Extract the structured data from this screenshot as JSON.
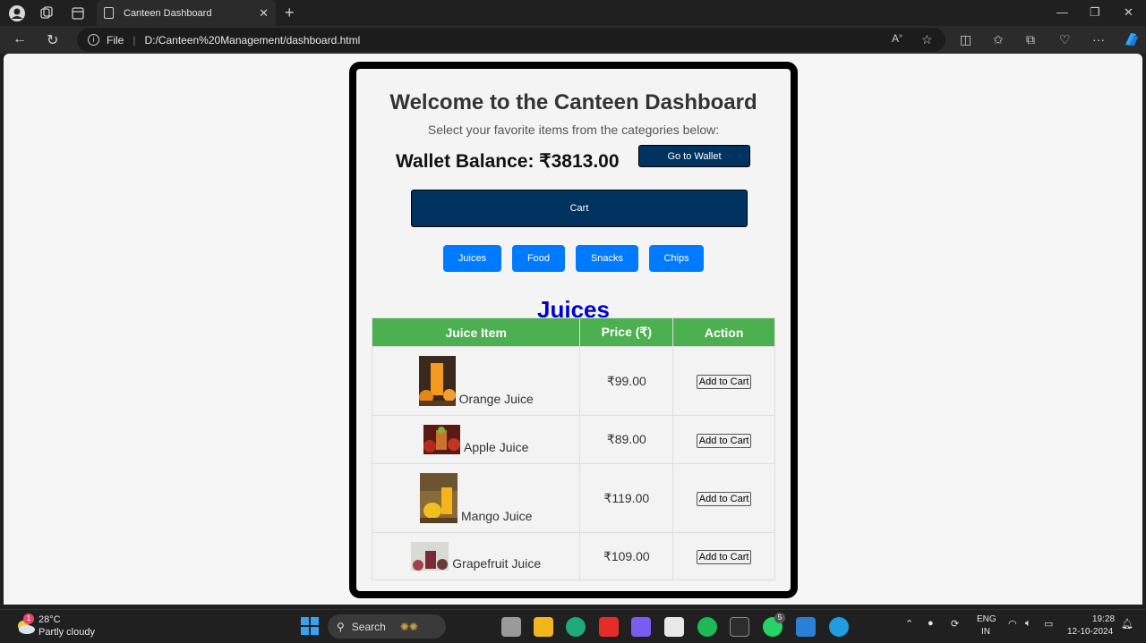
{
  "browser": {
    "tab_title": "Canteen Dashboard",
    "address_prefix": "File",
    "url": "D:/Canteen%20Management/dashboard.html"
  },
  "page": {
    "title": "Welcome to the Canteen Dashboard",
    "subtitle": "Select your favorite items from the categories below:",
    "wallet_balance": "Wallet Balance: ₹3813.00",
    "wallet_button": "Go to Wallet",
    "cart_button": "Cart",
    "categories": [
      "Juices",
      "Food",
      "Snacks",
      "Chips"
    ],
    "section_title": "Juices",
    "table": {
      "headers": [
        "Juice Item",
        "Price (₹)",
        "Action"
      ],
      "rows": [
        {
          "name": "Orange Juice",
          "price": "₹99.00",
          "action": "Add to Cart"
        },
        {
          "name": "Apple Juice",
          "price": "₹89.00",
          "action": "Add to Cart"
        },
        {
          "name": "Mango Juice",
          "price": "₹119.00",
          "action": "Add to Cart"
        },
        {
          "name": "Grapefruit Juice",
          "price": "₹109.00",
          "action": "Add to Cart"
        }
      ]
    }
  },
  "taskbar": {
    "weather_temp": "28°C",
    "weather_desc": "Partly cloudy",
    "search_label": "Search",
    "lang_top": "ENG",
    "lang_bottom": "IN",
    "time": "19:28",
    "date": "12-10-2024",
    "weather_badge": "1",
    "whatsapp_badge": "5"
  },
  "colors": {
    "accent_blue": "#007bff",
    "dark_navy": "#00335f",
    "table_header": "#4caf50",
    "section_title": "#0000cd"
  }
}
